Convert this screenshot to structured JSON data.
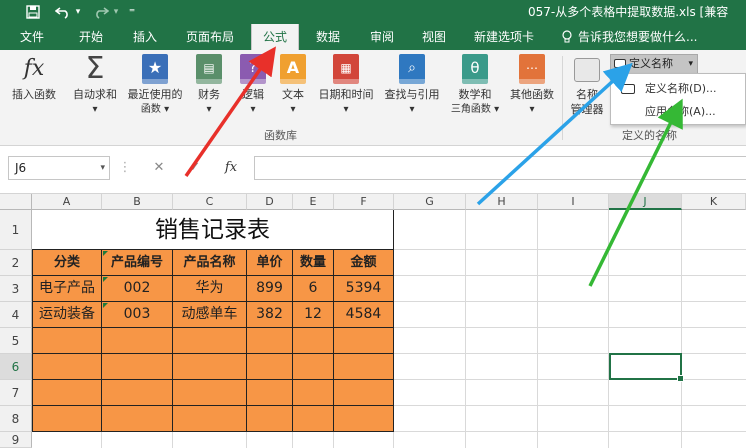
{
  "window": {
    "title": "057-从多个表格中提取数据.xls [兼容",
    "qat_icons": [
      "save-icon",
      "undo-icon",
      "undo-dropdown-icon",
      "redo-icon",
      "redo-dropdown-icon"
    ]
  },
  "menu_tabs": [
    "文件",
    "开始",
    "插入",
    "页面布局",
    "公式",
    "数据",
    "审阅",
    "视图",
    "新建选项卡"
  ],
  "active_tab": "公式",
  "tell_me": "告诉我您想要做什么...",
  "ribbon": {
    "buttons": [
      {
        "label": "插入函数",
        "label2": "",
        "icon": "fx-icon"
      },
      {
        "label": "自动求和",
        "label2": "▾",
        "icon": "sigma-icon"
      },
      {
        "label": "最近使用的",
        "label2": "函数 ▾",
        "icon": "star-book-icon"
      },
      {
        "label": "财务",
        "label2": "▾",
        "icon": "finance-book-icon"
      },
      {
        "label": "逻辑",
        "label2": "▾",
        "icon": "logic-book-icon"
      },
      {
        "label": "文本",
        "label2": "▾",
        "icon": "text-book-icon"
      },
      {
        "label": "日期和时间",
        "label2": "▾",
        "icon": "calendar-book-icon"
      },
      {
        "label": "查找与引用",
        "label2": "▾",
        "icon": "lookup-book-icon"
      },
      {
        "label": "数学和",
        "label2": "三角函数 ▾",
        "icon": "math-book-icon"
      },
      {
        "label": "其他函数",
        "label2": "▾",
        "icon": "more-book-icon"
      },
      {
        "label": "名称",
        "label2": "管理器",
        "icon": "name-manager-icon"
      }
    ],
    "group_function_library": "函数库",
    "group_defined_names": "定义的名称",
    "define_name_dropdown": "定义名称",
    "define_name_menu": [
      "定义名称(D)...",
      "应用名称(A)..."
    ]
  },
  "formula_bar": {
    "name_box": "J6",
    "cancel_symbol": "✕",
    "enter_symbol": "✓",
    "fx_symbol": "fx",
    "value": ""
  },
  "sheet": {
    "columns": [
      "A",
      "B",
      "C",
      "D",
      "E",
      "F",
      "G",
      "H",
      "I",
      "J",
      "K"
    ],
    "rows": [
      "1",
      "2",
      "3",
      "4",
      "5",
      "6",
      "7",
      "8",
      "9"
    ],
    "selected_cell": "J6",
    "title": "销售记录表",
    "headers": [
      "分类",
      "产品编号",
      "产品名称",
      "单价",
      "数量",
      "金额"
    ],
    "data": [
      [
        "电子产品",
        "002",
        "华为",
        "899",
        "6",
        "5394"
      ],
      [
        "运动装备",
        "003",
        "动感单车",
        "382",
        "12",
        "4584"
      ]
    ],
    "fill_color": "#f79646",
    "accent_color": "#217346"
  },
  "annotations": [
    {
      "name": "red-arrow",
      "color": "#e8302a"
    },
    {
      "name": "blue-arrow",
      "color": "#2ba2e8"
    },
    {
      "name": "green-arrow",
      "color": "#35b835"
    }
  ]
}
